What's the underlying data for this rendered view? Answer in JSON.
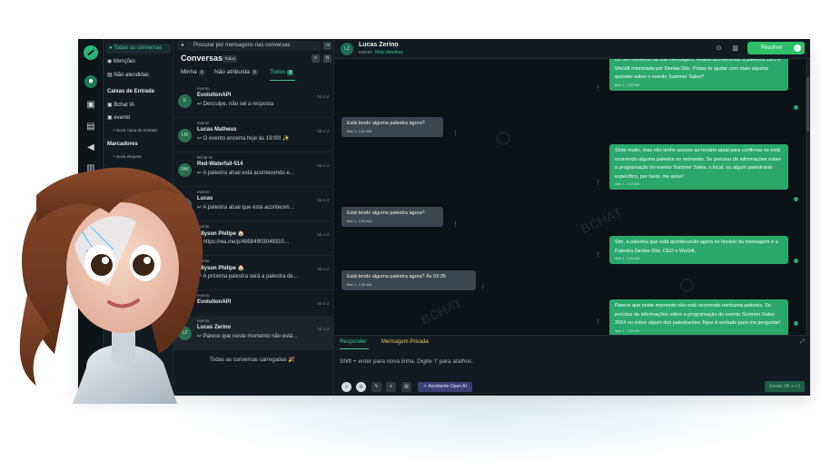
{
  "rail": {
    "icons": [
      "logo-icon",
      "inbox-icon",
      "contacts-icon",
      "reports-icon",
      "campaigns-icon",
      "library-icon",
      "settings-icon"
    ]
  },
  "menu": {
    "all_conversations": "Todas as conversas",
    "mentions": "Menções",
    "unattended": "Não atendidas",
    "inboxes_header": "Caixas de Entrada",
    "inbox_1": "Bchat IA",
    "inbox_2": "evento",
    "new_inbox": "Nova caixa de entrada",
    "labels_header": "Marcadores",
    "new_label": "Nova etiqueta"
  },
  "list": {
    "search_placeholder": "Procurar por mensagens nas conversas",
    "title": "Conversas",
    "title_badge": "Todos",
    "tabs": [
      {
        "label": "Minha",
        "count": "0"
      },
      {
        "label": "Não atribuída",
        "count": "8"
      },
      {
        "label": "Todos",
        "count": "8"
      }
    ],
    "conversations": [
      {
        "inbox": "evento",
        "name": "EvolutionAPI",
        "msg": "↩ Desculpe, não sei a resposta",
        "initials": "E",
        "time": "há 4 d"
      },
      {
        "inbox": "evento",
        "name": "Lucas Matheus",
        "msg": "↩ O evento encerra hoje às 19:00! ✨",
        "initials": "LM",
        "time": "há 4 d"
      },
      {
        "inbox": "Bchat IA",
        "name": "Red-Waterfall-514",
        "msg": "↩ A palestra atual está acontecendo e…",
        "initials": "RW",
        "time": "há 4 d"
      },
      {
        "inbox": "evento",
        "name": "Lucas",
        "msg": "↩ A palestra atual que está aconteceṅ…",
        "initials": "L",
        "time": "há 4 d"
      },
      {
        "inbox": "evento",
        "name": "Allyson Philipe 🏠",
        "msg": "↩ https://wa.me/p/49584903049310…",
        "initials": "AP",
        "time": "há 4 d"
      },
      {
        "inbox": "evento",
        "name": "Allyson Philipe 🏠",
        "msg": "↩ A próxima palestra será a palestra de…",
        "initials": "AP",
        "time": "há 4 d"
      },
      {
        "inbox": "evento",
        "name": "EvolutionAPI",
        "msg": "",
        "initials": "E",
        "time": "há 4 d"
      },
      {
        "inbox": "evento",
        "name": "Lucas Zerino",
        "msg": "↩ Parece que neste momento não está…",
        "initials": "LZ",
        "time": "há 4 d"
      }
    ],
    "loaded_text": "Todas as conversas carregadas 🎉"
  },
  "chat": {
    "contact_name": "Lucas Zerino",
    "contact_initials": "LZ",
    "inbox": "evento",
    "details_link": "Mais detalhes",
    "resolve_label": "Resolver",
    "messages": [
      {
        "dir": "out",
        "text": "Oi! No momento da sua mensagem, estava acontecendo a palestra CEO e WeGift ministrada por Denise Ditz. Posso te ajudar com mais alguma questão sobre o evento Summer Sales?",
        "time": "Mar 1, 2:22 AM"
      },
      {
        "dir": "in",
        "text": "Está tendo alguma palestra agora?",
        "time": "Mar 1, 2:22 AM"
      },
      {
        "dir": "out",
        "text": "Sinto muito, mas não tenho acesso ao horário atual para confirmar se está ocorrendo alguma palestra no momento. Se precisar de informações sobre a programação do evento Summer Sales, o local, ou algum palestrante específico, por favor, me avise!",
        "time": "Mar 1, 2:22 AM"
      },
      {
        "dir": "in",
        "text": "Está tendo alguma palestra agora?",
        "time": "Mar 1, 2:34 AM"
      },
      {
        "dir": "out",
        "text": "Sim, a palestra que está acontecendo agora no horário da mensagem é a Palestra Denise Ditz, CEO e WeGift.",
        "time": "Mar 1, 2:34 AM"
      },
      {
        "dir": "in",
        "text": "Está tendo alguma palestra agora? Às 02:35",
        "time": "Mar 1, 2:35 AM"
      },
      {
        "dir": "out",
        "text": "Parece que neste momento não está ocorrendo nenhuma palestra. Se precisar de informações sobre a programação do evento Summer Sales 2024 ou sobre algum dos palestrantes, fique à vontade para me perguntar!",
        "time": "Mar 1, 2:35 AM"
      }
    ]
  },
  "compose": {
    "reply_tab": "Responder",
    "private_tab": "Mensagem Privada",
    "placeholder": "Shift + enter para nova linha. Digite '/' para atalhos.",
    "ai_button": "Assistente Open AI",
    "send_label": "Enviar (⌘ + ↵)"
  },
  "colors": {
    "accent": "#2fbf6c",
    "outgoing": "#2aa86c",
    "incoming": "#3a4750",
    "background": "#111b21"
  }
}
